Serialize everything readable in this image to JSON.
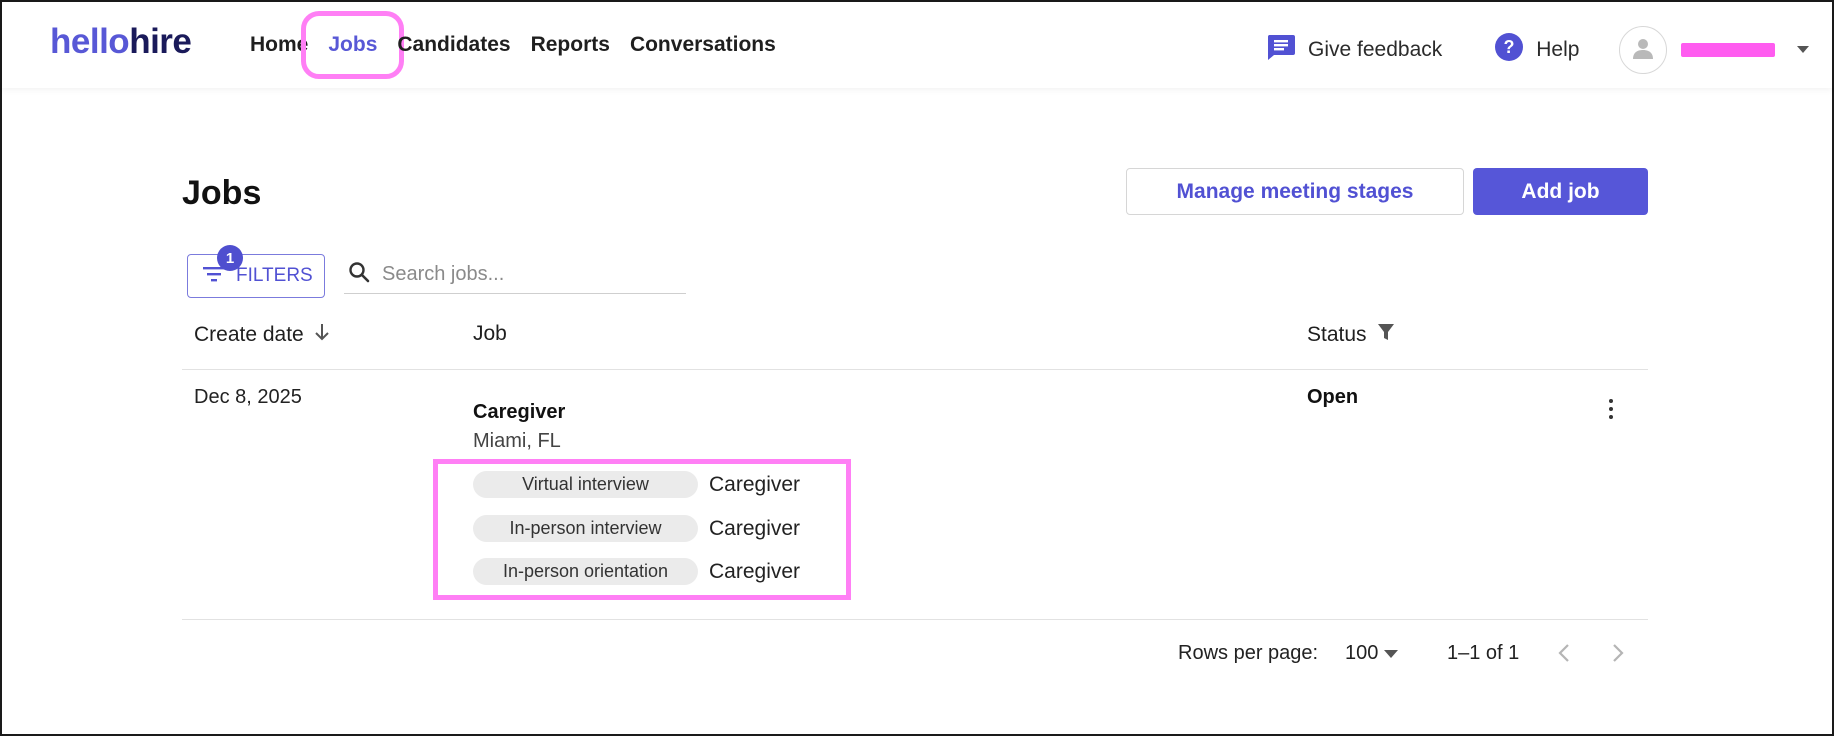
{
  "brand": {
    "hello": "hello",
    "hire": "hire"
  },
  "nav": {
    "items": [
      {
        "label": "Home"
      },
      {
        "label": "Jobs",
        "active": true
      },
      {
        "label": "Candidates"
      },
      {
        "label": "Reports"
      },
      {
        "label": "Conversations"
      }
    ]
  },
  "header_tools": {
    "feedback_label": "Give feedback",
    "help_label": "Help"
  },
  "page": {
    "title": "Jobs",
    "manage_stages_label": "Manage meeting stages",
    "add_job_label": "Add job"
  },
  "filters": {
    "label": "FILTERS",
    "count": "1"
  },
  "search": {
    "placeholder": "Search jobs..."
  },
  "table": {
    "columns": {
      "create_date": "Create date",
      "job": "Job",
      "status": "Status"
    },
    "rows": [
      {
        "create_date": "Dec 8, 2025",
        "job_title": "Caregiver",
        "location": "Miami, FL",
        "status": "Open",
        "stages": [
          {
            "type": "Virtual interview",
            "name": "Caregiver"
          },
          {
            "type": "In-person interview",
            "name": "Caregiver"
          },
          {
            "type": "In-person orientation",
            "name": "Caregiver"
          }
        ]
      }
    ]
  },
  "pagination": {
    "rows_per_page_label": "Rows per page:",
    "rows_per_page": "100",
    "range": "1–1 of 1"
  },
  "colors": {
    "accent": "#5656d8",
    "highlight": "#ff7ff5"
  }
}
